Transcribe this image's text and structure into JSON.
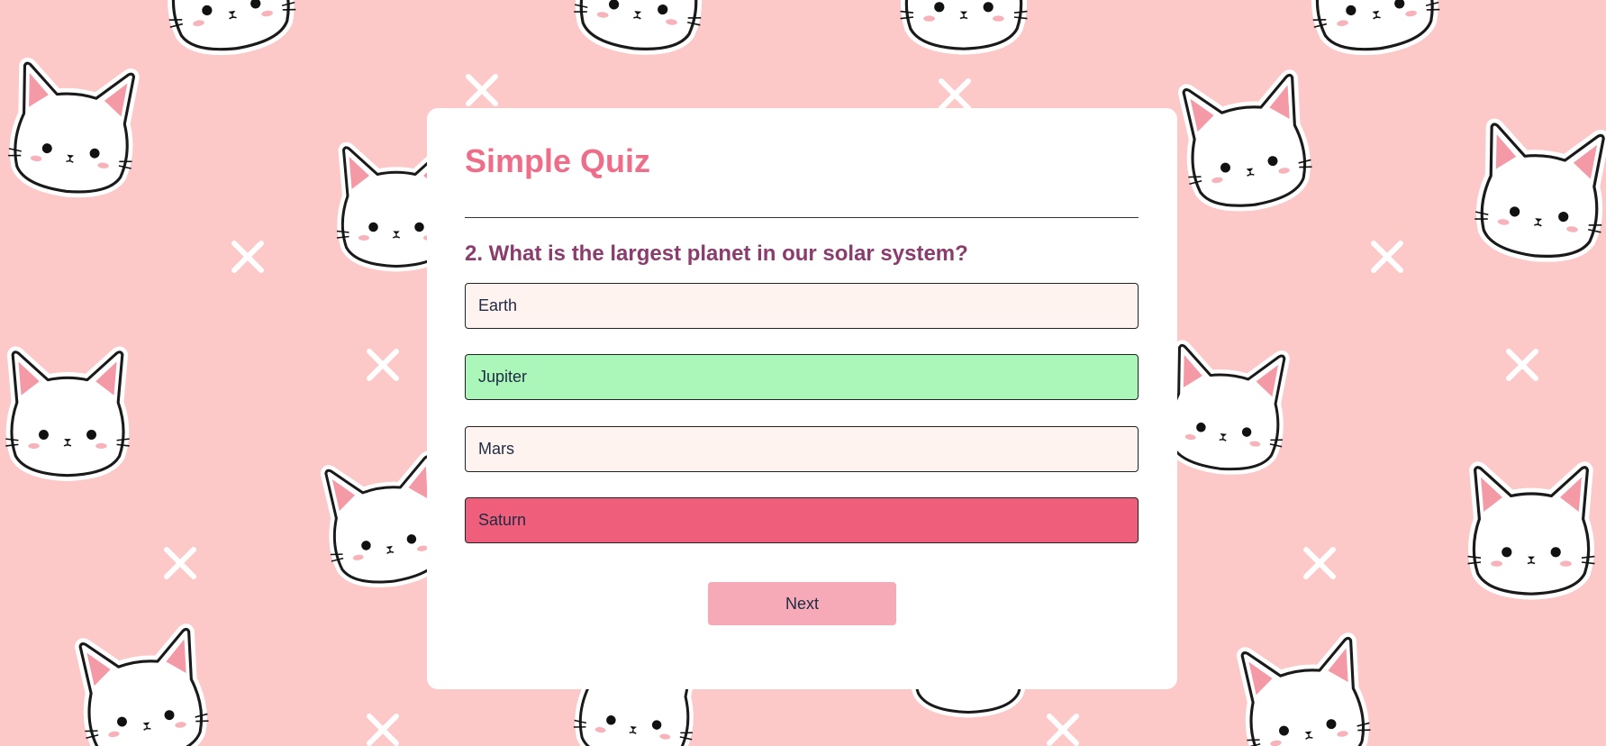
{
  "quiz": {
    "title": "Simple Quiz",
    "question": "2. What is the largest planet in our solar system?",
    "answers": [
      {
        "label": "Earth",
        "state": "neutral"
      },
      {
        "label": "Jupiter",
        "state": "correct"
      },
      {
        "label": "Mars",
        "state": "neutral"
      },
      {
        "label": "Saturn",
        "state": "wrong"
      }
    ],
    "next_label": "Next"
  },
  "colors": {
    "background": "#fcc8c8",
    "title": "#ee6e89",
    "question": "#8a3c6d",
    "answer_neutral": "#fff3ef",
    "answer_correct": "#abf7b9",
    "answer_wrong": "#ef5f7b",
    "next_button": "#f6aab7"
  },
  "background_pattern": {
    "motif": "cat-face-stickers-and-x-marks"
  }
}
